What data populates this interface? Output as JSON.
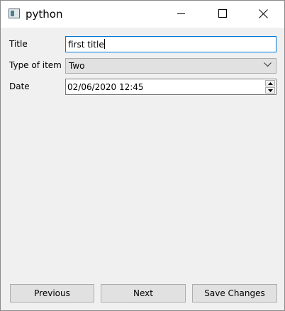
{
  "window": {
    "title": "python",
    "icon": "python-app-icon",
    "controls": [
      "minimize-icon",
      "maximize-icon",
      "close-icon"
    ]
  },
  "form": {
    "title_label": "Title",
    "title_value": "first title",
    "type_label": "Type of item",
    "type_value": "Two",
    "date_label": "Date",
    "date_value": "02/06/2020 12:45"
  },
  "buttons": {
    "previous": "Previous",
    "next": "Next",
    "save": "Save Changes"
  },
  "colors": {
    "focus_border": "#0078d7",
    "window_bg": "#f0f0f0",
    "button_bg": "#e1e1e1"
  }
}
